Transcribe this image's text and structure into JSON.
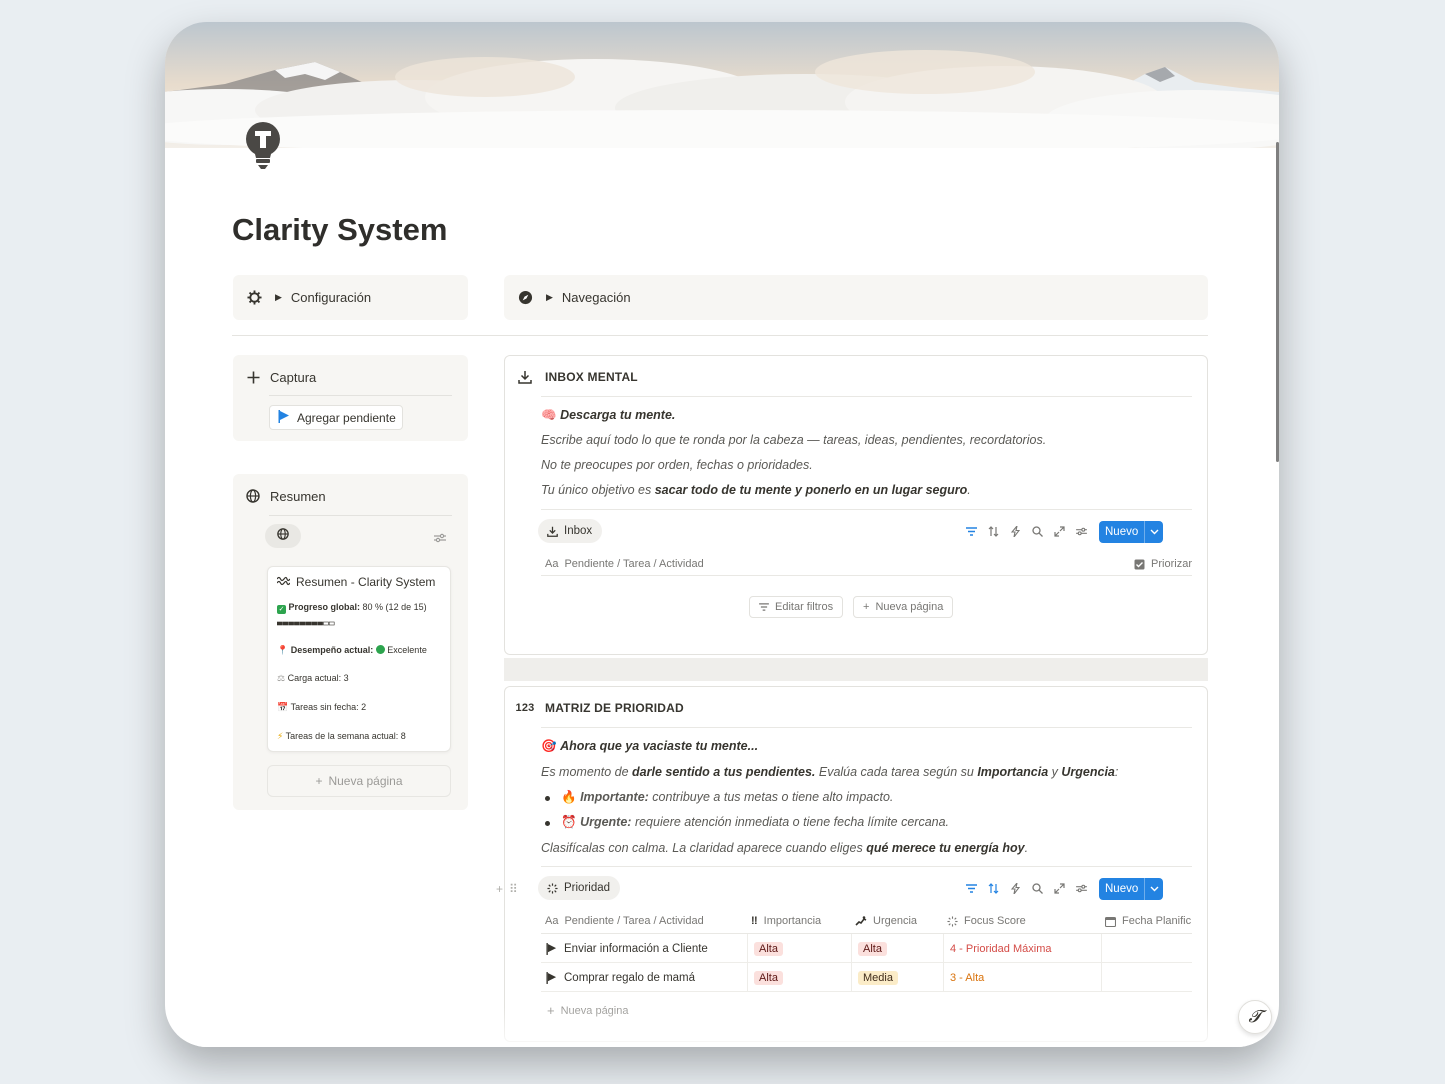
{
  "page": {
    "title": "Clarity System",
    "icon": "lightbulb-t-icon"
  },
  "toggles": {
    "config_label": "Configuración",
    "nav_label": "Navegación"
  },
  "captura": {
    "title": "Captura",
    "button_label": "Agregar pendiente"
  },
  "resumen": {
    "title": "Resumen",
    "card_title": "Resumen - Clarity System",
    "progress_label": "Progreso global:",
    "progress_value": "80 % (12 de 15)",
    "progress_fraction": 0.8,
    "performance_label": "Desempeño actual:",
    "performance_value": "Excelente",
    "load_line": "Carga actual: 3",
    "nodate_line": "Tareas sin fecha: 2",
    "week_line": "Tareas de la semana actual: 8",
    "new_page_label": "Nueva página"
  },
  "inbox": {
    "title": "INBOX MENTAL",
    "line1": "Descarga tu mente.",
    "line2": "Escribe aquí todo lo que te ronda por la cabeza — tareas, ideas, pendientes, recordatorios.",
    "line3": "No te preocupes por orden, fechas o prioridades.",
    "line4_a": "Tu único objetivo es ",
    "line4_b": "sacar todo de tu mente y ponerlo en un lugar seguro",
    "line4_c": ".",
    "view_label": "Inbox",
    "new_button": "Nuevo",
    "col_task": "Pendiente / Tarea / Actividad",
    "col_prioritize": "Priorizar",
    "edit_filters": "Editar filtros",
    "new_page": "Nueva página"
  },
  "matrix": {
    "title_prefix": "123",
    "title": "MATRIZ DE PRIORIDAD",
    "line1": "Ahora que ya vaciaste tu mente...",
    "line2_a": "Es momento de ",
    "line2_b": "darle sentido a tus pendientes.",
    "line2_c": " Evalúa cada tarea según su ",
    "line2_d": "Importancia",
    "line2_e": " y ",
    "line2_f": "Urgencia",
    "line2_g": ":",
    "bullet1_a": "Importante:",
    "bullet1_b": " contribuye a tus metas o tiene alto impacto.",
    "bullet2_a": "Urgente:",
    "bullet2_b": " requiere atención inmediata o tiene fecha límite cercana.",
    "line3_a": "Clasifícalas con calma. La claridad aparece cuando eliges ",
    "line3_b": "qué merece tu energía hoy",
    "line3_c": ".",
    "view_label": "Prioridad",
    "new_button": "Nuevo",
    "columns": [
      "Pendiente / Tarea / Actividad",
      "Importancia",
      "Urgencia",
      "Focus Score",
      "Fecha Planific"
    ],
    "rows": [
      {
        "task": "Enviar información a Cliente",
        "importance": "Alta",
        "urgency": "Alta",
        "score": "4 - Prioridad Máxima"
      },
      {
        "task": "Comprar regalo de mamá",
        "importance": "Alta",
        "urgency": "Media",
        "score": "3 - Alta"
      }
    ],
    "new_page": "Nueva página"
  },
  "colors": {
    "accent": "#2383e2",
    "tag_red_bg": "#fbe0dd",
    "tag_yellow_bg": "#fbecc8",
    "score_red": "#d44c47",
    "score_orange": "#d9730d"
  }
}
